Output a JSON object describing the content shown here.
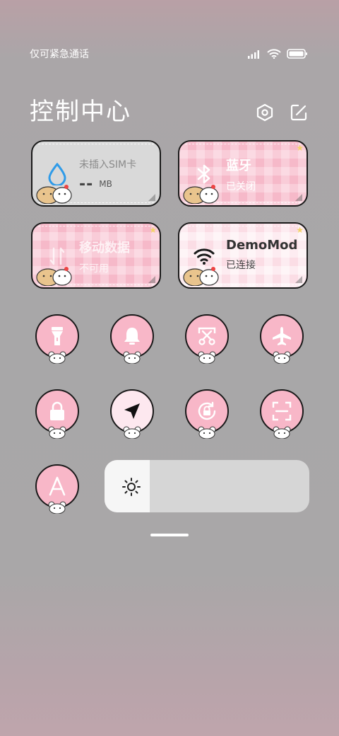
{
  "status_bar": {
    "carrier": "仅可紧急通话"
  },
  "header": {
    "title": "控制中心"
  },
  "tiles": [
    {
      "title": "未插入SIM卡",
      "value": "--",
      "unit": "MB"
    },
    {
      "title": "蓝牙",
      "status": "已关闭"
    },
    {
      "title": "移动数据",
      "status": "不可用"
    },
    {
      "title": "DemoMod",
      "status": "已连接"
    }
  ],
  "toggles": [
    {
      "icon": "flashlight-icon"
    },
    {
      "icon": "bell-icon"
    },
    {
      "icon": "screenshot-icon"
    },
    {
      "icon": "airplane-icon"
    },
    {
      "icon": "lock-icon"
    },
    {
      "icon": "location-icon"
    },
    {
      "icon": "rotation-lock-icon"
    },
    {
      "icon": "scan-icon"
    },
    {
      "icon": "font-icon"
    }
  ],
  "brightness": {
    "level": 0.22,
    "icon": "sun-icon"
  },
  "colors": {
    "tile_pink": "#f6b9c9",
    "tile_grey": "#d9d9d9",
    "tile_light": "#fbdde5",
    "toggle_pink": "#f8b7c8",
    "toggle_active": "#fde8ef",
    "water_blue": "#2f9be8"
  }
}
